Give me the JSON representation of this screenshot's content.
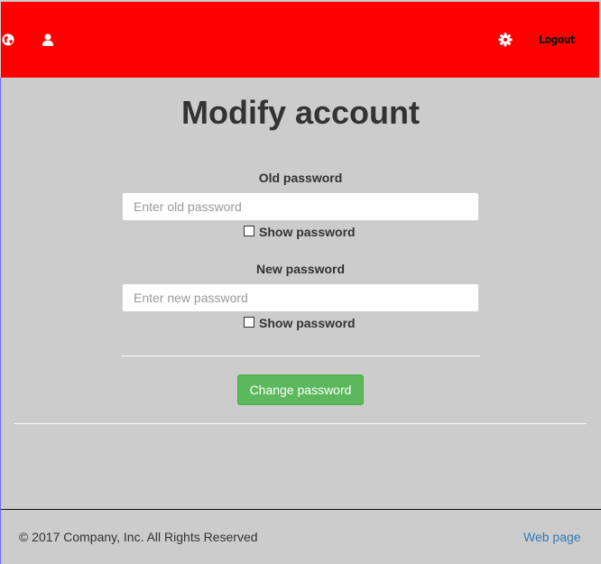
{
  "header": {
    "background": "#ff0000",
    "logout_label": "Logout",
    "icons": [
      "globe-icon",
      "user-icon",
      "gear-icon"
    ]
  },
  "main": {
    "title": "Modify account",
    "old_password": {
      "label": "Old password",
      "placeholder": "Enter old password",
      "show_label": "Show password"
    },
    "new_password": {
      "label": "New password",
      "placeholder": "Enter new password",
      "show_label": "Show password"
    },
    "submit_label": "Change password",
    "submit_color": "#5cb85c"
  },
  "footer": {
    "copyright": "© 2017 Company, Inc. All Rights Reserved",
    "link_label": "Web page",
    "link_color": "#337ab7"
  }
}
